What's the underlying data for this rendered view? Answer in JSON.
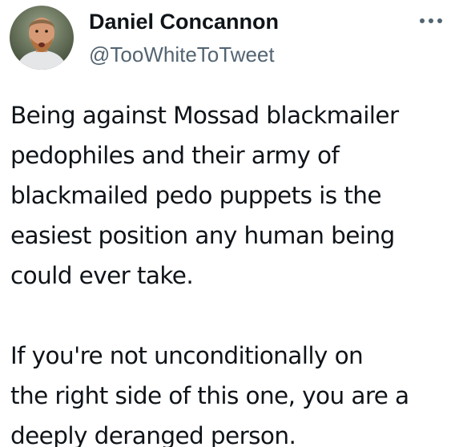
{
  "author": {
    "display_name": "Daniel Concannon",
    "handle": "@TooWhiteToTweet",
    "avatar_icon": "profile-photo"
  },
  "more_icon": "ellipsis-icon",
  "tweet": {
    "paragraphs": [
      "Being against Mossad blackmailer\npedophiles and their army of\nblackmailed pedo puppets is the\neasiest position any human being\ncould ever take.",
      "If you're not unconditionally on\nthe right side of this one, you are a\ndeeply deranged person."
    ]
  },
  "colors": {
    "text": "#0f1419",
    "secondary_text": "#536471",
    "background": "#ffffff"
  }
}
